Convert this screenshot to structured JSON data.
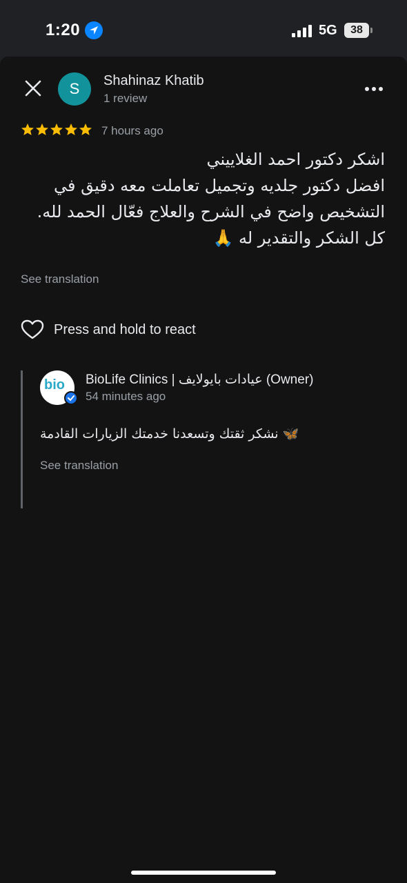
{
  "status_bar": {
    "time": "1:20",
    "network": "5G",
    "battery": "38"
  },
  "review": {
    "reviewer": {
      "name": "Shahinaz Khatib",
      "meta": "1 review",
      "avatar_letter": "S",
      "avatar_color": "#12939b"
    },
    "rating": 5,
    "time": "7 hours ago",
    "text_lines": [
      "اشكر دكتور احمد الغلاييني",
      "افضل دكتور جلديه وتجميل تعاملت معه دقيق في",
      "التشخيص واضح في الشرح والعلاج فعّال الحمد لله.",
      "كل الشكر والتقدير له 🙏"
    ],
    "see_translation": "See translation",
    "react_label": "Press and hold to react"
  },
  "owner_reply": {
    "name": "BioLife Clinics | عيادات بايولايف (Owner)",
    "time": "54 minutes ago",
    "logo_text": "bio",
    "text": "نشكر ثقتك وتسعدنا خدمتك الزيارات القادمة 🦋",
    "see_translation": "See translation"
  },
  "colors": {
    "background": "#131314",
    "star": "#fbbc04",
    "secondary_text": "#9aa0a6",
    "verified": "#1a73e8"
  },
  "icons": [
    "location-arrow-icon",
    "signal-icon",
    "battery-icon",
    "close-icon",
    "more-options-icon",
    "star-icon",
    "heart-icon",
    "verified-badge-icon"
  ]
}
